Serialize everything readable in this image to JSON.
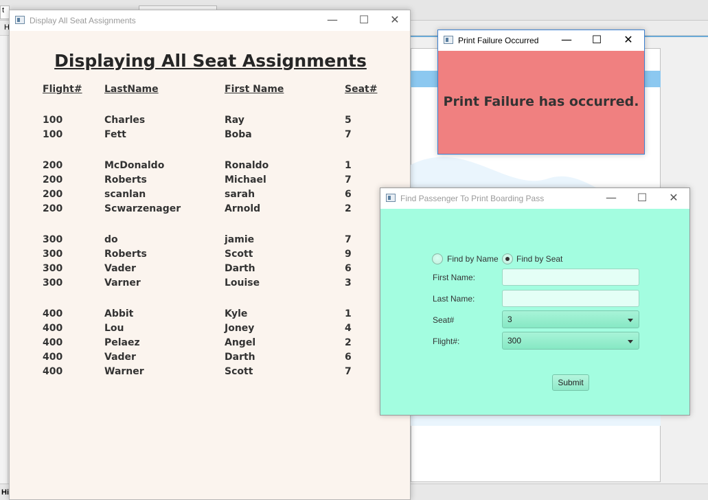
{
  "background": {
    "tab1_label": "t",
    "strip_label": "H",
    "bottom_label": "Hi"
  },
  "seats_window": {
    "title": "Display All Seat Assignments",
    "heading": "Displaying All Seat Assignments",
    "columns": {
      "flight": "Flight#",
      "last": "LastName",
      "first": "First Name",
      "seat": "Seat#"
    },
    "rows": [
      {
        "flight": "100",
        "last": "Charles",
        "first": "Ray",
        "seat": "5"
      },
      {
        "flight": "100",
        "last": "Fett",
        "first": "Boba",
        "seat": "7"
      },
      {
        "flight": "200",
        "last": "McDonaldo",
        "first": "Ronaldo",
        "seat": "1"
      },
      {
        "flight": "200",
        "last": "Roberts",
        "first": "Michael",
        "seat": "7"
      },
      {
        "flight": "200",
        "last": "scanlan",
        "first": "sarah",
        "seat": "6"
      },
      {
        "flight": "200",
        "last": "Scwarzenager",
        "first": "Arnold",
        "seat": "2"
      },
      {
        "flight": "300",
        "last": "do",
        "first": "jamie",
        "seat": "7"
      },
      {
        "flight": "300",
        "last": "Roberts",
        "first": "Scott",
        "seat": "9"
      },
      {
        "flight": "300",
        "last": "Vader",
        "first": "Darth",
        "seat": "6"
      },
      {
        "flight": "300",
        "last": "Varner",
        "first": "Louise",
        "seat": "3"
      },
      {
        "flight": "400",
        "last": "Abbit",
        "first": "Kyle",
        "seat": "1"
      },
      {
        "flight": "400",
        "last": "Lou",
        "first": "Joney",
        "seat": "4"
      },
      {
        "flight": "400",
        "last": "Pelaez",
        "first": "Angel",
        "seat": "2"
      },
      {
        "flight": "400",
        "last": "Vader",
        "first": "Darth",
        "seat": "6"
      },
      {
        "flight": "400",
        "last": "Warner",
        "first": "Scott",
        "seat": "7"
      }
    ]
  },
  "fail_window": {
    "title": "Print Failure Occurred",
    "message": "Print Failure has occurred.",
    "bg_color": "#f08080"
  },
  "find_window": {
    "title": "Find Passenger To Print Boarding Pass",
    "radio_name_label": "Find by Name",
    "radio_seat_label": "Find by Seat",
    "radio_selected": "seat",
    "first_name_label": "First Name:",
    "first_name_value": "",
    "last_name_label": "Last Name:",
    "last_name_value": "",
    "seat_label": "Seat#",
    "seat_value": "3",
    "flight_label": "Flight#:",
    "flight_value": "300",
    "submit_label": "Submit",
    "bg_color": "#a3fde0"
  },
  "window_controls": {
    "minimize": "—",
    "maximize": "☐",
    "close": "✕"
  }
}
